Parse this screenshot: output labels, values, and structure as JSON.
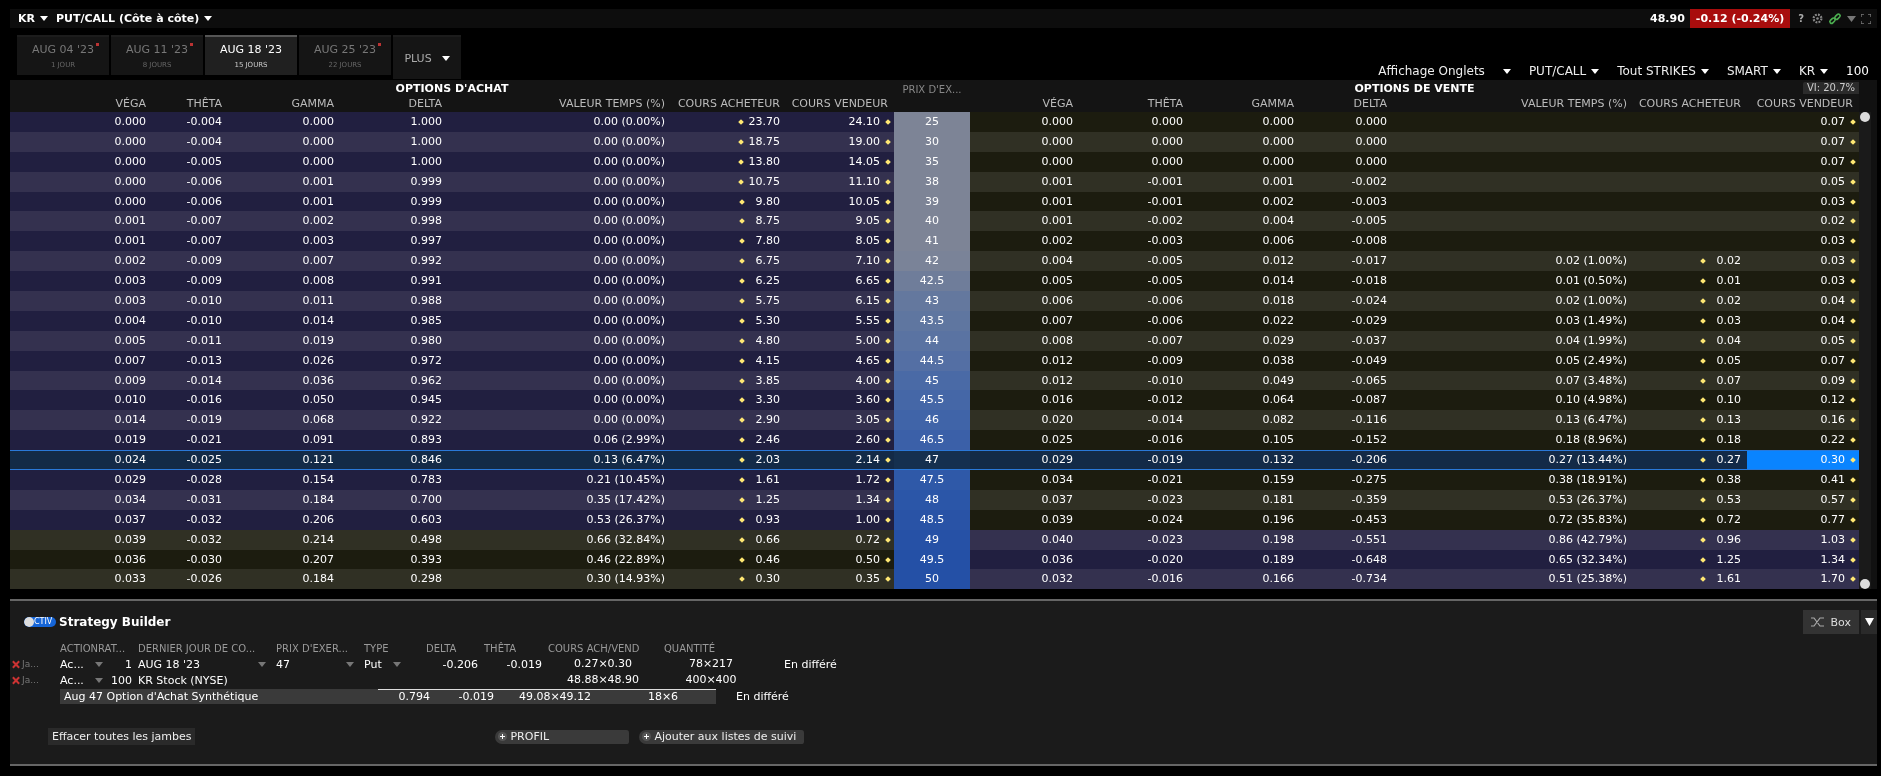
{
  "top_bar": {
    "symbol": "KR",
    "view": "PUT/CALL (Côte à côte)",
    "price": "48.90",
    "change": "-0.12 (-0.24%)",
    "help": "?"
  },
  "expiry_tabs": [
    {
      "date": "AUG 04 '23",
      "days": "1 JOUR",
      "marked": true,
      "selected": false
    },
    {
      "date": "AUG 11 '23",
      "days": "8 JOURS",
      "marked": true,
      "selected": false
    },
    {
      "date": "AUG 18 '23",
      "days": "15 JOURS",
      "marked": false,
      "selected": true
    },
    {
      "date": "AUG 25 '23",
      "days": "22 JOURS",
      "marked": true,
      "selected": false
    }
  ],
  "more_tab": "PLUS",
  "controls": [
    {
      "label": "Affichage Onglets",
      "kind": "dropdown"
    },
    {
      "label": "PUT/CALL",
      "kind": "dropdown"
    },
    {
      "label": "Tout STRIKES",
      "kind": "dropdown"
    },
    {
      "label": "SMART",
      "kind": "dropdown"
    },
    {
      "label": "KR",
      "kind": "dropdown"
    },
    {
      "label": "100",
      "kind": "text"
    }
  ],
  "chain": {
    "calls_title": "OPTIONS D'ACHAT",
    "puts_title": "OPTIONS DE VENTE",
    "strike_header": "PRIX D'EX...",
    "implied_volatility": "VI: 20.7%",
    "call_columns": [
      "VÉGA",
      "THÊTA",
      "GAMMA",
      "DELTA",
      "VALEUR TEMPS (%)",
      "COURS ACHETEUR",
      "COURS VENDEUR"
    ],
    "put_columns": [
      "VÉGA",
      "THÊTA",
      "GAMMA",
      "DELTA",
      "VALEUR TEMPS (%)",
      "COURS ACHETEUR",
      "COURS VENDEUR"
    ],
    "rows": [
      {
        "call": {
          "vega": "0.000",
          "theta": "-0.004",
          "gamma": "0.000",
          "delta": "1.000",
          "time_value": "0.00 (0.00%)",
          "bid": "23.70",
          "ask": "24.10"
        },
        "strike": "25",
        "put": {
          "vega": "0.000",
          "theta": "0.000",
          "gamma": "0.000",
          "delta": "0.000",
          "ask": "0.07"
        },
        "call_itm": true,
        "put_itm": false,
        "selected": false,
        "color": "#7d8496"
      },
      {
        "call": {
          "vega": "0.000",
          "theta": "-0.004",
          "gamma": "0.000",
          "delta": "1.000",
          "time_value": "0.00 (0.00%)",
          "bid": "18.75",
          "ask": "19.00"
        },
        "strike": "30",
        "put": {
          "vega": "0.000",
          "theta": "0.000",
          "gamma": "0.000",
          "delta": "0.000",
          "ask": "0.07"
        },
        "call_itm": true,
        "put_itm": false,
        "selected": false,
        "color": "#7d8496"
      },
      {
        "call": {
          "vega": "0.000",
          "theta": "-0.005",
          "gamma": "0.000",
          "delta": "1.000",
          "time_value": "0.00 (0.00%)",
          "bid": "13.80",
          "ask": "14.05"
        },
        "strike": "35",
        "put": {
          "vega": "0.000",
          "theta": "0.000",
          "gamma": "0.000",
          "delta": "0.000",
          "ask": "0.07"
        },
        "call_itm": true,
        "put_itm": false,
        "selected": false,
        "color": "#7d8496"
      },
      {
        "call": {
          "vega": "0.000",
          "theta": "-0.006",
          "gamma": "0.001",
          "delta": "0.999",
          "time_value": "0.00 (0.00%)",
          "bid": "10.75",
          "ask": "11.10"
        },
        "strike": "38",
        "put": {
          "vega": "0.001",
          "theta": "-0.001",
          "gamma": "0.001",
          "delta": "-0.002",
          "ask": "0.05"
        },
        "call_itm": true,
        "put_itm": false,
        "selected": false,
        "color": "#7d8496"
      },
      {
        "call": {
          "vega": "0.000",
          "theta": "-0.006",
          "gamma": "0.001",
          "delta": "0.999",
          "time_value": "0.00 (0.00%)",
          "bid": "9.80",
          "ask": "10.05"
        },
        "strike": "39",
        "put": {
          "vega": "0.001",
          "theta": "-0.001",
          "gamma": "0.002",
          "delta": "-0.003",
          "ask": "0.03"
        },
        "call_itm": true,
        "put_itm": false,
        "selected": false,
        "color": "#7d8496"
      },
      {
        "call": {
          "vega": "0.001",
          "theta": "-0.007",
          "gamma": "0.002",
          "delta": "0.998",
          "time_value": "0.00 (0.00%)",
          "bid": "8.75",
          "ask": "9.05"
        },
        "strike": "40",
        "put": {
          "vega": "0.001",
          "theta": "-0.002",
          "gamma": "0.004",
          "delta": "-0.005",
          "ask": "0.02"
        },
        "call_itm": true,
        "put_itm": false,
        "selected": false,
        "color": "#7d8496"
      },
      {
        "call": {
          "vega": "0.001",
          "theta": "-0.007",
          "gamma": "0.003",
          "delta": "0.997",
          "time_value": "0.00 (0.00%)",
          "bid": "7.80",
          "ask": "8.05"
        },
        "strike": "41",
        "put": {
          "vega": "0.002",
          "theta": "-0.003",
          "gamma": "0.006",
          "delta": "-0.008",
          "ask": "0.03"
        },
        "call_itm": true,
        "put_itm": false,
        "selected": false,
        "color": "#7d8496"
      },
      {
        "call": {
          "vega": "0.002",
          "theta": "-0.009",
          "gamma": "0.007",
          "delta": "0.992",
          "time_value": "0.00 (0.00%)",
          "bid": "6.75",
          "ask": "7.10"
        },
        "strike": "42",
        "put": {
          "vega": "0.004",
          "theta": "-0.005",
          "gamma": "0.012",
          "delta": "-0.017",
          "time_value": "0.02 (1.00%)",
          "bid": "0.02",
          "ask": "0.03"
        },
        "call_itm": true,
        "put_itm": false,
        "selected": false,
        "color": "#7a8398"
      },
      {
        "call": {
          "vega": "0.003",
          "theta": "-0.009",
          "gamma": "0.008",
          "delta": "0.991",
          "time_value": "0.00 (0.00%)",
          "bid": "6.25",
          "ask": "6.65"
        },
        "strike": "42.5",
        "put": {
          "vega": "0.005",
          "theta": "-0.005",
          "gamma": "0.014",
          "delta": "-0.018",
          "time_value": "0.01 (0.50%)",
          "bid": "0.01",
          "ask": "0.03"
        },
        "call_itm": true,
        "put_itm": false,
        "selected": false,
        "color": "#6f7d9a"
      },
      {
        "call": {
          "vega": "0.003",
          "theta": "-0.010",
          "gamma": "0.011",
          "delta": "0.988",
          "time_value": "0.00 (0.00%)",
          "bid": "5.75",
          "ask": "6.15"
        },
        "strike": "43",
        "put": {
          "vega": "0.006",
          "theta": "-0.006",
          "gamma": "0.018",
          "delta": "-0.024",
          "time_value": "0.02 (1.00%)",
          "bid": "0.02",
          "ask": "0.04"
        },
        "call_itm": true,
        "put_itm": false,
        "selected": false,
        "color": "#64789e"
      },
      {
        "call": {
          "vega": "0.004",
          "theta": "-0.010",
          "gamma": "0.014",
          "delta": "0.985",
          "time_value": "0.00 (0.00%)",
          "bid": "5.30",
          "ask": "5.55"
        },
        "strike": "43.5",
        "put": {
          "vega": "0.007",
          "theta": "-0.006",
          "gamma": "0.022",
          "delta": "-0.029",
          "time_value": "0.03 (1.49%)",
          "bid": "0.03",
          "ask": "0.04"
        },
        "call_itm": true,
        "put_itm": false,
        "selected": false,
        "color": "#5f76a0"
      },
      {
        "call": {
          "vega": "0.005",
          "theta": "-0.011",
          "gamma": "0.019",
          "delta": "0.980",
          "time_value": "0.00 (0.00%)",
          "bid": "4.80",
          "ask": "5.00"
        },
        "strike": "44",
        "put": {
          "vega": "0.008",
          "theta": "-0.007",
          "gamma": "0.029",
          "delta": "-0.037",
          "time_value": "0.04 (1.99%)",
          "bid": "0.04",
          "ask": "0.05"
        },
        "call_itm": true,
        "put_itm": false,
        "selected": false,
        "color": "#5a73a2"
      },
      {
        "call": {
          "vega": "0.007",
          "theta": "-0.013",
          "gamma": "0.026",
          "delta": "0.972",
          "time_value": "0.00 (0.00%)",
          "bid": "4.15",
          "ask": "4.65"
        },
        "strike": "44.5",
        "put": {
          "vega": "0.012",
          "theta": "-0.009",
          "gamma": "0.038",
          "delta": "-0.049",
          "time_value": "0.05 (2.49%)",
          "bid": "0.05",
          "ask": "0.07"
        },
        "call_itm": true,
        "put_itm": false,
        "selected": false,
        "color": "#546fa4"
      },
      {
        "call": {
          "vega": "0.009",
          "theta": "-0.014",
          "gamma": "0.036",
          "delta": "0.962",
          "time_value": "0.00 (0.00%)",
          "bid": "3.85",
          "ask": "4.00"
        },
        "strike": "45",
        "put": {
          "vega": "0.012",
          "theta": "-0.010",
          "gamma": "0.049",
          "delta": "-0.065",
          "time_value": "0.07 (3.48%)",
          "bid": "0.07",
          "ask": "0.09"
        },
        "call_itm": true,
        "put_itm": false,
        "selected": false,
        "color": "#4a6aa6"
      },
      {
        "call": {
          "vega": "0.010",
          "theta": "-0.016",
          "gamma": "0.050",
          "delta": "0.945",
          "time_value": "0.00 (0.00%)",
          "bid": "3.30",
          "ask": "3.60"
        },
        "strike": "45.5",
        "put": {
          "vega": "0.016",
          "theta": "-0.012",
          "gamma": "0.064",
          "delta": "-0.087",
          "time_value": "0.10 (4.98%)",
          "bid": "0.10",
          "ask": "0.12"
        },
        "call_itm": true,
        "put_itm": false,
        "selected": false,
        "color": "#4567a7"
      },
      {
        "call": {
          "vega": "0.014",
          "theta": "-0.019",
          "gamma": "0.068",
          "delta": "0.922",
          "time_value": "0.00 (0.00%)",
          "bid": "2.90",
          "ask": "3.05"
        },
        "strike": "46",
        "put": {
          "vega": "0.020",
          "theta": "-0.014",
          "gamma": "0.082",
          "delta": "-0.116",
          "time_value": "0.13 (6.47%)",
          "bid": "0.13",
          "ask": "0.16"
        },
        "call_itm": true,
        "put_itm": false,
        "selected": false,
        "color": "#4064a8"
      },
      {
        "call": {
          "vega": "0.019",
          "theta": "-0.021",
          "gamma": "0.091",
          "delta": "0.893",
          "time_value": "0.06 (2.99%)",
          "bid": "2.46",
          "ask": "2.60"
        },
        "strike": "46.5",
        "put": {
          "vega": "0.025",
          "theta": "-0.016",
          "gamma": "0.105",
          "delta": "-0.152",
          "time_value": "0.18 (8.96%)",
          "bid": "0.18",
          "ask": "0.22"
        },
        "call_itm": true,
        "put_itm": false,
        "selected": false,
        "color": "#3b60a8"
      },
      {
        "call": {
          "vega": "0.024",
          "theta": "-0.025",
          "gamma": "0.121",
          "delta": "0.846",
          "time_value": "0.13 (6.47%)",
          "bid": "2.03",
          "ask": "2.14"
        },
        "strike": "47",
        "put": {
          "vega": "0.029",
          "theta": "-0.019",
          "gamma": "0.132",
          "delta": "-0.206",
          "time_value": "0.27 (13.44%)",
          "bid": "0.27",
          "ask": "0.30"
        },
        "call_itm": true,
        "put_itm": false,
        "selected": true,
        "color": "#15304f"
      },
      {
        "call": {
          "vega": "0.029",
          "theta": "-0.028",
          "gamma": "0.154",
          "delta": "0.783",
          "time_value": "0.21 (10.45%)",
          "bid": "1.61",
          "ask": "1.72"
        },
        "strike": "47.5",
        "put": {
          "vega": "0.034",
          "theta": "-0.021",
          "gamma": "0.159",
          "delta": "-0.275",
          "time_value": "0.38 (18.91%)",
          "bid": "0.38",
          "ask": "0.41"
        },
        "call_itm": true,
        "put_itm": false,
        "selected": false,
        "color": "#2f59a8"
      },
      {
        "call": {
          "vega": "0.034",
          "theta": "-0.031",
          "gamma": "0.184",
          "delta": "0.700",
          "time_value": "0.35 (17.42%)",
          "bid": "1.25",
          "ask": "1.34"
        },
        "strike": "48",
        "put": {
          "vega": "0.037",
          "theta": "-0.023",
          "gamma": "0.181",
          "delta": "-0.359",
          "time_value": "0.53 (26.37%)",
          "bid": "0.53",
          "ask": "0.57"
        },
        "call_itm": true,
        "put_itm": false,
        "selected": false,
        "color": "#2b56a8"
      },
      {
        "call": {
          "vega": "0.037",
          "theta": "-0.032",
          "gamma": "0.206",
          "delta": "0.603",
          "time_value": "0.53 (26.37%)",
          "bid": "0.93",
          "ask": "1.00"
        },
        "strike": "48.5",
        "put": {
          "vega": "0.039",
          "theta": "-0.024",
          "gamma": "0.196",
          "delta": "-0.453",
          "time_value": "0.72 (35.83%)",
          "bid": "0.72",
          "ask": "0.77"
        },
        "call_itm": true,
        "put_itm": false,
        "selected": false,
        "color": "#2953a6"
      },
      {
        "call": {
          "vega": "0.039",
          "theta": "-0.032",
          "gamma": "0.214",
          "delta": "0.498",
          "time_value": "0.66 (32.84%)",
          "bid": "0.66",
          "ask": "0.72"
        },
        "strike": "49",
        "put": {
          "vega": "0.040",
          "theta": "-0.023",
          "gamma": "0.198",
          "delta": "-0.551",
          "time_value": "0.86 (42.79%)",
          "bid": "0.96",
          "ask": "1.03"
        },
        "call_itm": false,
        "put_itm": true,
        "selected": false,
        "color": "#2651a6"
      },
      {
        "call": {
          "vega": "0.036",
          "theta": "-0.030",
          "gamma": "0.207",
          "delta": "0.393",
          "time_value": "0.46 (22.89%)",
          "bid": "0.46",
          "ask": "0.50"
        },
        "strike": "49.5",
        "put": {
          "vega": "0.036",
          "theta": "-0.020",
          "gamma": "0.189",
          "delta": "-0.648",
          "time_value": "0.65 (32.34%)",
          "bid": "1.25",
          "ask": "1.34"
        },
        "call_itm": false,
        "put_itm": true,
        "selected": false,
        "color": "#2450a6"
      },
      {
        "call": {
          "vega": "0.033",
          "theta": "-0.026",
          "gamma": "0.184",
          "delta": "0.298",
          "time_value": "0.30 (14.93%)",
          "bid": "0.30",
          "ask": "0.35"
        },
        "strike": "50",
        "put": {
          "vega": "0.032",
          "theta": "-0.016",
          "gamma": "0.166",
          "delta": "-0.734",
          "time_value": "0.51 (25.38%)",
          "bid": "1.61",
          "ask": "1.70"
        },
        "call_itm": false,
        "put_itm": true,
        "selected": false,
        "color": "#2450a6"
      }
    ]
  },
  "strategy_builder": {
    "title": "Strategy Builder",
    "toggle_label": "CTIV",
    "active": true,
    "box_button": "Box",
    "columns": [
      "ACTIONRAT...",
      "DERNIER JOUR DE CO...",
      "PRIX D'EXER...",
      "TYPE",
      "DELTA",
      "THÊTA",
      "COURS ACH/VEND",
      "QUANTITÉ"
    ],
    "legs": [
      {
        "account": "Ja...",
        "action": "Ac...",
        "ratio": "1",
        "expiry": "AUG 18 '23",
        "strike": "47",
        "type": "Put",
        "delta": "-0.206",
        "theta": "-0.019",
        "bid_ask": "0.27×0.30",
        "quantity": "78×217",
        "status": "En différé"
      },
      {
        "account": "Ja...",
        "action": "Ac...",
        "ratio": "100",
        "expiry": "KR Stock (NYSE)",
        "bid_ask": "48.88×48.90",
        "quantity": "400×400"
      }
    ],
    "summary": {
      "name": "Aug 47 Option d'Achat Synthétique",
      "delta": "0.794",
      "theta": "-0.019",
      "bid_ask": "49.08×49.12",
      "quantity": "18×6",
      "status": "En différé"
    },
    "buttons": [
      {
        "label": "Effacer toutes les jambes",
        "kind": "plain"
      },
      {
        "label": "PROFIL",
        "kind": "add"
      },
      {
        "label": "Ajouter aux listes de suivi",
        "kind": "add"
      }
    ]
  }
}
